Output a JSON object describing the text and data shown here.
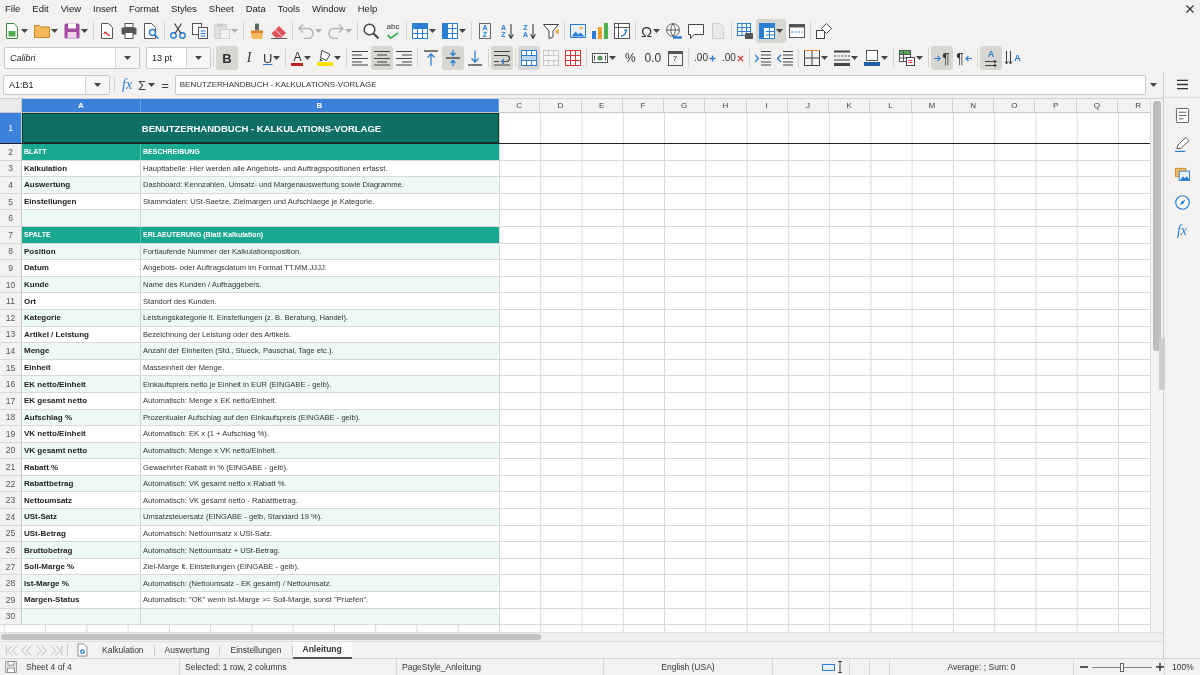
{
  "menu_bar": {
    "items": [
      "File",
      "Edit",
      "View",
      "Insert",
      "Format",
      "Styles",
      "Sheet",
      "Data",
      "Tools",
      "Window",
      "Help"
    ]
  },
  "standard_toolbar": {
    "buttons": [
      {
        "pressed": false,
        "disabled": false
      },
      {
        "pressed": false,
        "disabled": false
      },
      {
        "pressed": false,
        "disabled": false
      },
      {
        "pressed": false,
        "disabled": false
      },
      {
        "pressed": false,
        "disabled": false
      },
      {
        "pressed": false,
        "disabled": false
      },
      {
        "pressed": false,
        "disabled": false
      },
      {
        "pressed": false,
        "disabled": false
      },
      {
        "pressed": false,
        "disabled": true
      },
      {
        "pressed": false,
        "disabled": false
      },
      {
        "pressed": false,
        "disabled": false
      },
      {
        "pressed": false,
        "disabled": true
      },
      {
        "pressed": false,
        "disabled": true
      },
      {
        "pressed": false,
        "disabled": false
      },
      {
        "glyph": "abc",
        "pressed": false,
        "disabled": false
      },
      {
        "pressed": false,
        "disabled": false
      },
      {
        "pressed": false,
        "disabled": false
      },
      {
        "glyph": "AZ",
        "pressed": false,
        "disabled": false
      },
      {
        "glyph": "AZ",
        "pressed": false,
        "disabled": false
      },
      {
        "glyph": "ZA",
        "pressed": false,
        "disabled": false
      },
      {
        "pressed": false,
        "disabled": false
      },
      {
        "pressed": false,
        "disabled": false
      },
      {
        "pressed": false,
        "disabled": false
      },
      {
        "pressed": false,
        "disabled": false
      },
      {
        "glyph": "Ω",
        "pressed": false,
        "disabled": false
      },
      {
        "pressed": false,
        "disabled": false
      },
      {
        "pressed": false,
        "disabled": false
      },
      {
        "pressed": false,
        "disabled": true
      },
      {
        "pressed": false,
        "disabled": false
      },
      {
        "pressed": true,
        "disabled": false
      },
      {
        "pressed": false,
        "disabled": false
      },
      {
        "pressed": false,
        "disabled": false
      }
    ]
  },
  "formatting_toolbar": {
    "font_name": "Calibri",
    "font_size": "13 pt",
    "buttons": [
      {
        "glyph": "B",
        "pressed": true,
        "disabled": false
      },
      {
        "glyph": "I",
        "pressed": false,
        "disabled": false
      },
      {
        "glyph": "U",
        "pressed": false,
        "disabled": false
      },
      {
        "glyph": "A",
        "pressed": false,
        "disabled": false
      },
      {
        "pressed": false,
        "disabled": false
      },
      {
        "pressed": false,
        "disabled": false
      },
      {
        "pressed": true,
        "disabled": false
      },
      {
        "pressed": false,
        "disabled": false
      },
      {
        "pressed": false,
        "disabled": false
      },
      {
        "pressed": true,
        "disabled": false
      },
      {
        "pressed": false,
        "disabled": false
      },
      {
        "pressed": true,
        "disabled": false
      },
      {
        "pressed": true,
        "disabled": false
      },
      {
        "pressed": false,
        "disabled": true
      },
      {
        "pressed": false,
        "disabled": false
      },
      {
        "pressed": false,
        "disabled": false
      },
      {
        "glyph": "%",
        "pressed": false,
        "disabled": false
      },
      {
        "glyph": "0.0",
        "pressed": false,
        "disabled": false
      },
      {
        "glyph": "7",
        "pressed": false,
        "disabled": false
      },
      {
        "glyph": ".00",
        "pressed": false,
        "disabled": false
      },
      {
        "glyph": ".00",
        "pressed": false,
        "disabled": false
      },
      {
        "pressed": false,
        "disabled": false
      },
      {
        "pressed": false,
        "disabled": false
      },
      {
        "pressed": false,
        "disabled": false
      },
      {
        "pressed": false,
        "disabled": false
      },
      {
        "pressed": false,
        "disabled": false
      },
      {
        "pressed": false,
        "disabled": false
      },
      {
        "glyph": "¶",
        "pressed": true,
        "disabled": false
      },
      {
        "glyph": "¶",
        "pressed": false,
        "disabled": false
      },
      {
        "glyph": "A",
        "pressed": true,
        "disabled": false
      },
      {
        "glyph": "A",
        "pressed": false,
        "disabled": false
      }
    ]
  },
  "formula_bar": {
    "name_box": "A1:B1",
    "function_wizard": "fx",
    "sum": "Σ",
    "equals": "=",
    "content": "BENUTZERHANDBUCH - KALKULATIONS-VORLAGE"
  },
  "sidebar": {
    "functions": "fx"
  },
  "sheet": {
    "columns": [
      {
        "label": "A",
        "selected": true
      },
      {
        "label": "B",
        "selected": true
      },
      {
        "label": "C",
        "selected": false
      },
      {
        "label": "D",
        "selected": false
      },
      {
        "label": "E",
        "selected": false
      },
      {
        "label": "F",
        "selected": false
      },
      {
        "label": "G",
        "selected": false
      },
      {
        "label": "H",
        "selected": false
      },
      {
        "label": "I",
        "selected": false
      },
      {
        "label": "J",
        "selected": false
      },
      {
        "label": "K",
        "selected": false
      },
      {
        "label": "L",
        "selected": false
      },
      {
        "label": "M",
        "selected": false
      },
      {
        "label": "N",
        "selected": false
      },
      {
        "label": "O",
        "selected": false
      },
      {
        "label": "P",
        "selected": false
      },
      {
        "label": "Q",
        "selected": false
      },
      {
        "label": "R",
        "selected": false
      }
    ],
    "rows": [
      {
        "number": "1",
        "selected": true,
        "kind": "title",
        "color": "#0e6f64",
        "cells": [
          "BENUTZERHANDBUCH - KALKULATIONS-VORLAGE"
        ]
      },
      {
        "number": "2",
        "selected": false,
        "kind": "header",
        "color": "#19a890",
        "cells": [
          "BLATT",
          "BESCHREIBUNG"
        ]
      },
      {
        "number": "3",
        "selected": false,
        "kind": "entry",
        "color": "#ffffff",
        "cells": [
          "Kalkulation",
          "Haupttabelle: Hier werden alle Angebots- und Auftragspositionen erfasst."
        ]
      },
      {
        "number": "4",
        "selected": false,
        "kind": "entry",
        "color": "#edf9f6",
        "cells": [
          "Auswertung",
          "Dashboard: Kennzahlen, Umsatz- und Margenauswertung sowie Diagramme."
        ]
      },
      {
        "number": "5",
        "selected": false,
        "kind": "entry",
        "color": "#ffffff",
        "cells": [
          "Einstellungen",
          "Stammdaten: USt-Saetze, Zielmargen und Aufschlaege je Kategorie."
        ]
      },
      {
        "number": "6",
        "selected": false,
        "kind": "blank",
        "color": "#edf9f6"
      },
      {
        "number": "7",
        "selected": false,
        "kind": "header",
        "color": "#19a890",
        "cells": [
          "SPALTE",
          "ERLAEUTERUNG (Blatt Kalkulation)"
        ]
      },
      {
        "number": "8",
        "selected": false,
        "kind": "entry",
        "color": "#edf9f6",
        "cells": [
          "Position",
          "Fortlaufende Nummer der Kalkulationsposition."
        ]
      },
      {
        "number": "9",
        "selected": false,
        "kind": "entry",
        "color": "#ffffff",
        "cells": [
          "Datum",
          "Angebots- oder Auftragsdatum im Format TT.MM.JJJJ."
        ]
      },
      {
        "number": "10",
        "selected": false,
        "kind": "entry",
        "color": "#edf9f6",
        "cells": [
          "Kunde",
          "Name des Kunden / Auftraggebers."
        ]
      },
      {
        "number": "11",
        "selected": false,
        "kind": "entry",
        "color": "#ffffff",
        "cells": [
          "Ort",
          "Standort des Kunden."
        ]
      },
      {
        "number": "12",
        "selected": false,
        "kind": "entry",
        "color": "#edf9f6",
        "cells": [
          "Kategorie",
          "Leistungskategorie lt. Einstellungen (z. B. Beratung, Handel)."
        ]
      },
      {
        "number": "13",
        "selected": false,
        "kind": "entry",
        "color": "#ffffff",
        "cells": [
          "Artikel / Leistung",
          "Bezeichnung der Leistung oder des Artikels."
        ]
      },
      {
        "number": "14",
        "selected": false,
        "kind": "entry",
        "color": "#edf9f6",
        "cells": [
          "Menge",
          "Anzahl der Einheiten (Std., Stueck, Pauschal, Tage etc.)."
        ]
      },
      {
        "number": "15",
        "selected": false,
        "kind": "entry",
        "color": "#ffffff",
        "cells": [
          "Einheit",
          "Masseinheit der Menge."
        ]
      },
      {
        "number": "16",
        "selected": false,
        "kind": "entry",
        "color": "#edf9f6",
        "cells": [
          "EK netto/Einheit",
          "Einkaufspreis netto je Einheit in EUR (EINGABE - gelb)."
        ]
      },
      {
        "number": "17",
        "selected": false,
        "kind": "entry",
        "color": "#ffffff",
        "cells": [
          "EK gesamt netto",
          "Automatisch: Menge x EK netto/Einheit."
        ]
      },
      {
        "number": "18",
        "selected": false,
        "kind": "entry",
        "color": "#edf9f6",
        "cells": [
          "Aufschlag %",
          "Prozentualer Aufschlag auf den Einkaufspreis (EINGABE - gelb)."
        ]
      },
      {
        "number": "19",
        "selected": false,
        "kind": "entry",
        "color": "#ffffff",
        "cells": [
          "VK netto/Einheit",
          "Automatisch: EK x (1 + Aufschlag %)."
        ]
      },
      {
        "number": "20",
        "selected": false,
        "kind": "entry",
        "color": "#edf9f6",
        "cells": [
          "VK gesamt netto",
          "Automatisch: Menge x VK netto/Einheit."
        ]
      },
      {
        "number": "21",
        "selected": false,
        "kind": "entry",
        "color": "#ffffff",
        "cells": [
          "Rabatt %",
          "Gewaehrter Rabatt in % (EINGABE - gelb)."
        ]
      },
      {
        "number": "22",
        "selected": false,
        "kind": "entry",
        "color": "#edf9f6",
        "cells": [
          "Rabattbetrag",
          "Automatisch: VK gesamt netto x Rabatt %."
        ]
      },
      {
        "number": "23",
        "selected": false,
        "kind": "entry",
        "color": "#ffffff",
        "cells": [
          "Nettoumsatz",
          "Automatisch: VK gesamt netto - Rabattbetrag."
        ]
      },
      {
        "number": "24",
        "selected": false,
        "kind": "entry",
        "color": "#edf9f6",
        "cells": [
          "USt-Satz",
          "Umsatzsteuersatz (EINGABE - gelb, Standard 19 %)."
        ]
      },
      {
        "number": "25",
        "selected": false,
        "kind": "entry",
        "color": "#ffffff",
        "cells": [
          "USt-Betrag",
          "Automatisch: Nettoumsatz x USt-Satz."
        ]
      },
      {
        "number": "26",
        "selected": false,
        "kind": "entry",
        "color": "#edf9f6",
        "cells": [
          "Bruttobetrag",
          "Automatisch: Nettoumsatz + USt-Betrag."
        ]
      },
      {
        "number": "27",
        "selected": false,
        "kind": "entry",
        "color": "#ffffff",
        "cells": [
          "Soll-Marge %",
          "Ziel-Marge lt. Einstellungen (EINGABE - gelb)."
        ]
      },
      {
        "number": "28",
        "selected": false,
        "kind": "entry",
        "color": "#edf9f6",
        "cells": [
          "Ist-Marge %",
          "Automatisch: (Nettoumsatz - EK gesamt) / Nettoumsatz."
        ]
      },
      {
        "number": "29",
        "selected": false,
        "kind": "entry",
        "color": "#ffffff",
        "cells": [
          "Margen-Status",
          "Automatisch: \"OK\" wenn Ist-Marge >= Soll-Marge, sonst \"Pruefen\"."
        ]
      },
      {
        "number": "30",
        "selected": false,
        "kind": "blank",
        "color": "#edf9f6"
      }
    ]
  },
  "sheet_navigation": [
    {
      "disabled": true
    },
    {
      "disabled": true
    },
    {
      "disabled": true
    },
    {
      "disabled": true
    }
  ],
  "sheet_tabs": [
    {
      "label": "Kalkulation",
      "selected": false
    },
    {
      "label": "Auswertung",
      "selected": false
    },
    {
      "label": "Einstellungen",
      "selected": false
    },
    {
      "label": "Anleitung",
      "selected": true
    }
  ],
  "status_bar": {
    "sheet_position": "Sheet 4 of 4",
    "selection": "Selected: 1 row, 2 columns",
    "page_style": "PageStyle_Anleitung",
    "language": "English (USA)",
    "summary": "Average: ; Sum: 0",
    "zoom_slider": {
      "level": 0.5
    },
    "zoom_percent": "100%"
  }
}
